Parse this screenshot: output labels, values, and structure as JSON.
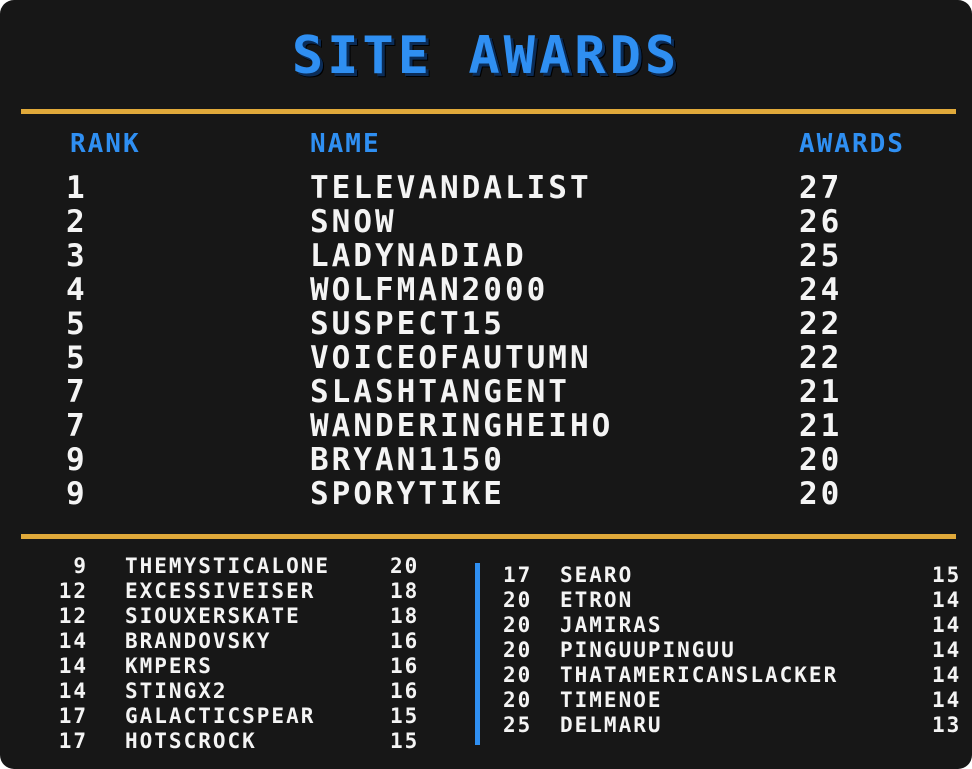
{
  "title": "SITE AWARDS",
  "headers": {
    "rank": "RANK",
    "name": "NAME",
    "awards": "AWARDS"
  },
  "top": [
    {
      "rank": "1",
      "name": "TELEVANDALIST",
      "awards": "27"
    },
    {
      "rank": "2",
      "name": "SNOW",
      "awards": "26"
    },
    {
      "rank": "3",
      "name": "LADYNADIAD",
      "awards": "25"
    },
    {
      "rank": "4",
      "name": "WOLFMAN2000",
      "awards": "24"
    },
    {
      "rank": "5",
      "name": "SUSPECT15",
      "awards": "22"
    },
    {
      "rank": "5",
      "name": "VOICEOFAUTUMN",
      "awards": "22"
    },
    {
      "rank": "7",
      "name": "SLASHTANGENT",
      "awards": "21"
    },
    {
      "rank": "7",
      "name": "WANDERINGHEIHO",
      "awards": "21"
    },
    {
      "rank": "9",
      "name": "BRYAN1150",
      "awards": "20"
    },
    {
      "rank": "9",
      "name": "SPORYTIKE",
      "awards": "20"
    }
  ],
  "left_list": [
    {
      "rank": "9",
      "name": "THEMYSTICALONE",
      "awards": "20"
    },
    {
      "rank": "12",
      "name": "EXCESSIVEISER",
      "awards": "18"
    },
    {
      "rank": "12",
      "name": "SIOUXERSKATE",
      "awards": "18"
    },
    {
      "rank": "14",
      "name": "BRANDOVSKY",
      "awards": "16"
    },
    {
      "rank": "14",
      "name": "KMPERS",
      "awards": "16"
    },
    {
      "rank": "14",
      "name": "STINGX2",
      "awards": "16"
    },
    {
      "rank": "17",
      "name": "GALACTICSPEAR",
      "awards": "15"
    },
    {
      "rank": "17",
      "name": "HOTSCROCK",
      "awards": "15"
    }
  ],
  "right_list": [
    {
      "rank": "17",
      "name": "SEARO",
      "awards": "15"
    },
    {
      "rank": "20",
      "name": "ETRON",
      "awards": "14"
    },
    {
      "rank": "20",
      "name": "JAMIRAS",
      "awards": "14"
    },
    {
      "rank": "20",
      "name": "PINGUUPINGUU",
      "awards": "14"
    },
    {
      "rank": "20",
      "name": "THATAMERICANSLACKER",
      "awards": "14"
    },
    {
      "rank": "20",
      "name": "TIMENOE",
      "awards": "14"
    },
    {
      "rank": "25",
      "name": "DELMARU",
      "awards": "13"
    }
  ],
  "colors": {
    "background": "#171717",
    "title": "#2f8ff2",
    "header": "#2f8ff2",
    "divider": "#e0a93a",
    "text": "#f4f4f4",
    "column_separator": "#2f8ff2"
  }
}
